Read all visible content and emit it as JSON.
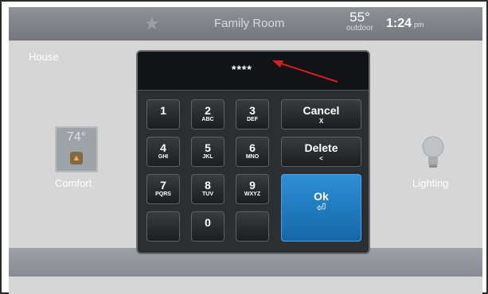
{
  "topbar": {
    "room_name": "Family Room",
    "outdoor_temp": "55°",
    "outdoor_label": "outdoor",
    "time": "1:24",
    "ampm": "pm"
  },
  "home": {
    "section_label": "House",
    "comfort_temp": "74°",
    "comfort_label": "Comfort",
    "lighting_label": "Lighting"
  },
  "keypad": {
    "display": "****",
    "keys": [
      {
        "digit": "1",
        "letters": ""
      },
      {
        "digit": "2",
        "letters": "ABC"
      },
      {
        "digit": "3",
        "letters": "DEF"
      },
      {
        "digit": "4",
        "letters": "GHI"
      },
      {
        "digit": "5",
        "letters": "JKL"
      },
      {
        "digit": "6",
        "letters": "MNO"
      },
      {
        "digit": "7",
        "letters": "PQRS"
      },
      {
        "digit": "8",
        "letters": "TUV"
      },
      {
        "digit": "9",
        "letters": "WXYZ"
      },
      {
        "digit": "0",
        "letters": ""
      }
    ],
    "cancel": {
      "label": "Cancel",
      "sub": "X"
    },
    "delete": {
      "label": "Delete",
      "sub": "<"
    },
    "ok": {
      "label": "Ok",
      "sub": "⏎"
    }
  },
  "icons": {
    "favorite": "star-icon",
    "comfort": "flame-icon",
    "lighting": "lightbulb-icon",
    "annotation": "red-arrow"
  },
  "colors": {
    "ok_button": "#1f7bc2",
    "arrow": "#d42020"
  }
}
